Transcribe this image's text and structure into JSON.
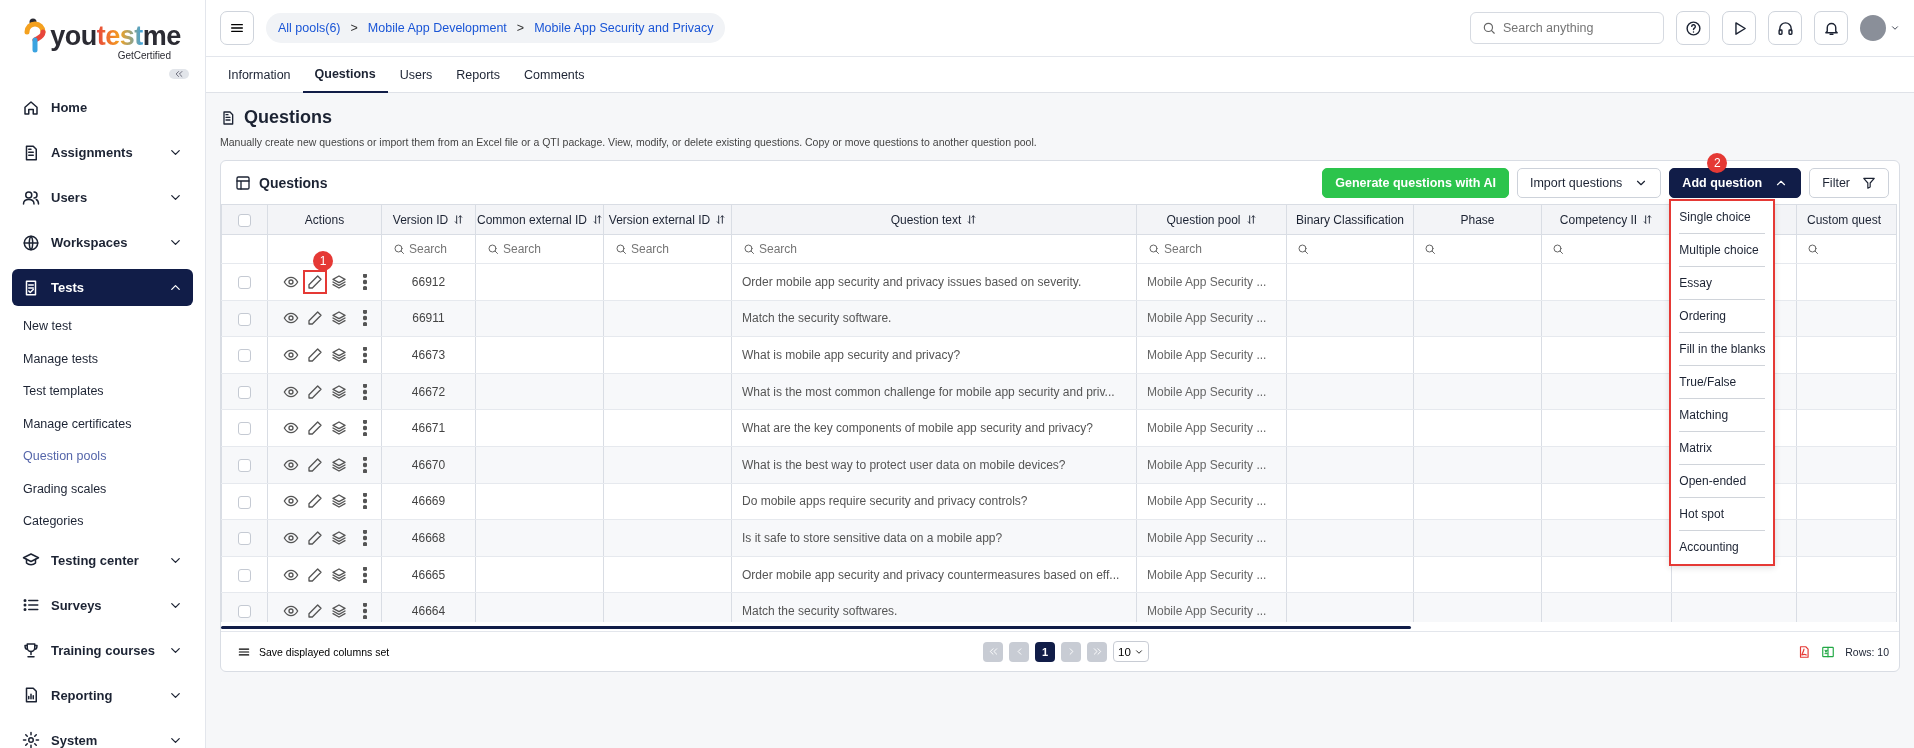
{
  "logo": {
    "parts": [
      {
        "text": "you",
        "kind": "plain"
      },
      {
        "text": "test",
        "kind": "accent"
      },
      {
        "text": "me",
        "kind": "plain"
      }
    ],
    "tagline": "GetCertified"
  },
  "sidebar": {
    "items": [
      {
        "label": "Home",
        "kind": "link",
        "selected": false
      },
      {
        "label": "Assignments",
        "kind": "group",
        "expanded": false,
        "selected": false
      },
      {
        "label": "Users",
        "kind": "group",
        "expanded": false,
        "selected": false
      },
      {
        "label": "Workspaces",
        "kind": "group",
        "expanded": false,
        "selected": false
      },
      {
        "label": "Tests",
        "kind": "group",
        "expanded": true,
        "selected": true,
        "children": [
          {
            "label": "New test",
            "selected": false
          },
          {
            "label": "Manage tests",
            "selected": false
          },
          {
            "label": "Test templates",
            "selected": false
          },
          {
            "label": "Manage certificates",
            "selected": false
          },
          {
            "label": "Question pools",
            "selected": true
          },
          {
            "label": "Grading scales",
            "selected": false
          },
          {
            "label": "Categories",
            "selected": false
          }
        ]
      },
      {
        "label": "Testing center",
        "kind": "group",
        "expanded": false,
        "selected": false
      },
      {
        "label": "Surveys",
        "kind": "group",
        "expanded": false,
        "selected": false
      },
      {
        "label": "Training courses",
        "kind": "group",
        "expanded": false,
        "selected": false
      },
      {
        "label": "Reporting",
        "kind": "group",
        "expanded": false,
        "selected": false
      },
      {
        "label": "System",
        "kind": "group",
        "expanded": false,
        "selected": false
      }
    ]
  },
  "breadcrumb": {
    "separator": ">",
    "items": [
      "All pools(6)",
      "Mobile App Development",
      "Mobile App Security and Privacy"
    ]
  },
  "search": {
    "placeholder": "Search anything"
  },
  "tabs": [
    {
      "label": "Information",
      "selected": false
    },
    {
      "label": "Questions",
      "selected": true
    },
    {
      "label": "Users",
      "selected": false
    },
    {
      "label": "Reports",
      "selected": false
    },
    {
      "label": "Comments",
      "selected": false
    }
  ],
  "page": {
    "title": "Questions",
    "description": "Manually create new questions or import them from an Excel file or a QTI package. View, modify, or delete existing questions. Copy or move questions to another question pool."
  },
  "card": {
    "title": "Questions",
    "buttons": [
      {
        "label": "Generate questions with AI",
        "kind": "ai"
      },
      {
        "label": "Import questions",
        "kind": "dropdown",
        "expanded": false
      },
      {
        "label": "Add question",
        "kind": "dropdown",
        "expanded": true,
        "marker": "2"
      },
      {
        "label": "Filter",
        "kind": "filter"
      }
    ],
    "add_menu": [
      "Single choice",
      "Multiple choice",
      "Essay",
      "Ordering",
      "Fill in the blanks",
      "True/False",
      "Matching",
      "Matrix",
      "Open-ended",
      "Hot spot",
      "Accounting"
    ]
  },
  "table": {
    "select_all": {
      "checked": false
    },
    "columns": [
      {
        "kind": "actions",
        "label": "Actions"
      },
      {
        "kind": "data",
        "label": "Version ID",
        "sortable": true,
        "search_placeholder": "Search"
      },
      {
        "kind": "data",
        "label": "Common external ID",
        "sortable": true,
        "search_placeholder": "Search"
      },
      {
        "kind": "data",
        "label": "Version external ID",
        "sortable": true,
        "search_placeholder": "Search"
      },
      {
        "kind": "data",
        "label": "Question text",
        "sortable": true,
        "search_placeholder": "Search"
      },
      {
        "kind": "data",
        "label": "Question pool",
        "sortable": true,
        "search_placeholder": "Search"
      },
      {
        "kind": "data",
        "label": "Binary Classification",
        "sortable": false,
        "searchable": true
      },
      {
        "kind": "data",
        "label": "Phase",
        "sortable": false,
        "searchable": true
      },
      {
        "kind": "data",
        "label": "Competency II",
        "sortable": true,
        "searchable": true
      },
      {
        "kind": "data",
        "sortable": false,
        "searchable": false
      },
      {
        "kind": "data",
        "label": "Custom quest",
        "sortable": false,
        "searchable": true
      }
    ],
    "rows": [
      {
        "checked": false,
        "edit_marker": "1",
        "version_id": "66912",
        "question_text": "Order mobile app security and privacy issues based on severity.",
        "question_pool": "Mobile App Security ..."
      },
      {
        "checked": false,
        "version_id": "66911",
        "question_text": "Match the security software.",
        "question_pool": "Mobile App Security ..."
      },
      {
        "checked": false,
        "version_id": "46673",
        "question_text": "What is mobile app security and privacy?",
        "question_pool": "Mobile App Security ..."
      },
      {
        "checked": false,
        "version_id": "46672",
        "question_text": "What is the most common challenge for mobile app security and priv...",
        "question_pool": "Mobile App Security ..."
      },
      {
        "checked": false,
        "version_id": "46671",
        "question_text": "What are the key components of mobile app security and privacy?",
        "question_pool": "Mobile App Security ..."
      },
      {
        "checked": false,
        "version_id": "46670",
        "question_text": "What is the best way to protect user data on mobile devices?",
        "question_pool": "Mobile App Security ..."
      },
      {
        "checked": false,
        "version_id": "46669",
        "question_text": "Do mobile apps require security and privacy controls?",
        "question_pool": "Mobile App Security ..."
      },
      {
        "checked": false,
        "version_id": "46668",
        "question_text": "Is it safe to store sensitive data on a mobile app?",
        "question_pool": "Mobile App Security ..."
      },
      {
        "checked": false,
        "version_id": "46665",
        "question_text": "Order mobile app security and privacy countermeasures based on eff...",
        "question_pool": "Mobile App Security ..."
      },
      {
        "checked": false,
        "version_id": "46664",
        "question_text": "Match the security softwares.",
        "question_pool": "Mobile App Security ..."
      }
    ]
  },
  "footer": {
    "save_columns": "Save displayed columns set",
    "pages": [
      {
        "label": "1",
        "selected": true
      }
    ],
    "page_size": "10",
    "rows_count": "Rows: 10"
  }
}
